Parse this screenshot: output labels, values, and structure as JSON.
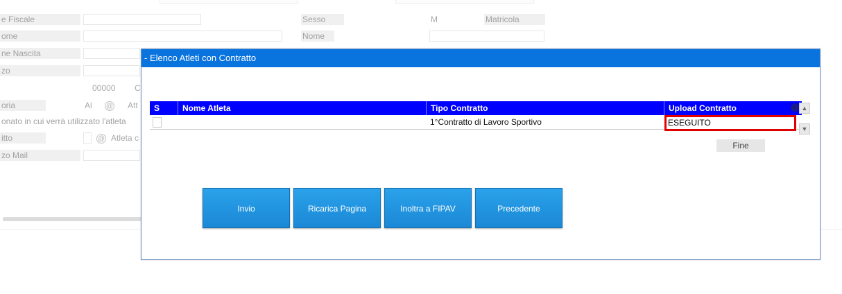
{
  "background_form": {
    "labels": {
      "codice_fiscale": "e Fiscale",
      "cognome": "ome",
      "data_nascita": "ne Nascita",
      "indirizzo": "zo",
      "categoria": "oria",
      "tesseramento": "onato in cui verrà utilizzato l'atleta",
      "contratto": "itto",
      "indirizzo_mail": "zo Mail",
      "sesso": "Sesso",
      "nome": "Nome",
      "matricola": "Matricola"
    },
    "values": {
      "sesso": "M",
      "cap": "00000",
      "cap_suffix": "C",
      "categoria": "Al",
      "categoria_suffix": "Att",
      "contratto_suffix": "Atleta c"
    },
    "icons": {
      "lookup": "@"
    }
  },
  "dialog": {
    "title": "- Elenco Atleti con Contratto",
    "columns": {
      "select": "S",
      "nome_atleta": "Nome Atleta",
      "tipo_contratto": "Tipo Contratto",
      "upload_contratto": "Upload Contratto"
    },
    "rows": [
      {
        "nome_atleta": "",
        "tipo_contratto": "1°Contratto di Lavoro Sportivo",
        "upload_contratto": "ESEGUITO"
      }
    ],
    "fine_label": "Fine",
    "buttons": {
      "invio": "Invio",
      "ricarica": "Ricarica Pagina",
      "inoltra": "Inoltra a FIPAV",
      "precedente": "Precedente"
    },
    "icons": {
      "scroll_up": "▲",
      "scroll_down": "▼"
    }
  },
  "colors": {
    "title_bar": "#0a74de",
    "grid_header": "#0000ff",
    "highlight": "#e00000",
    "button": "#1b88d6"
  }
}
